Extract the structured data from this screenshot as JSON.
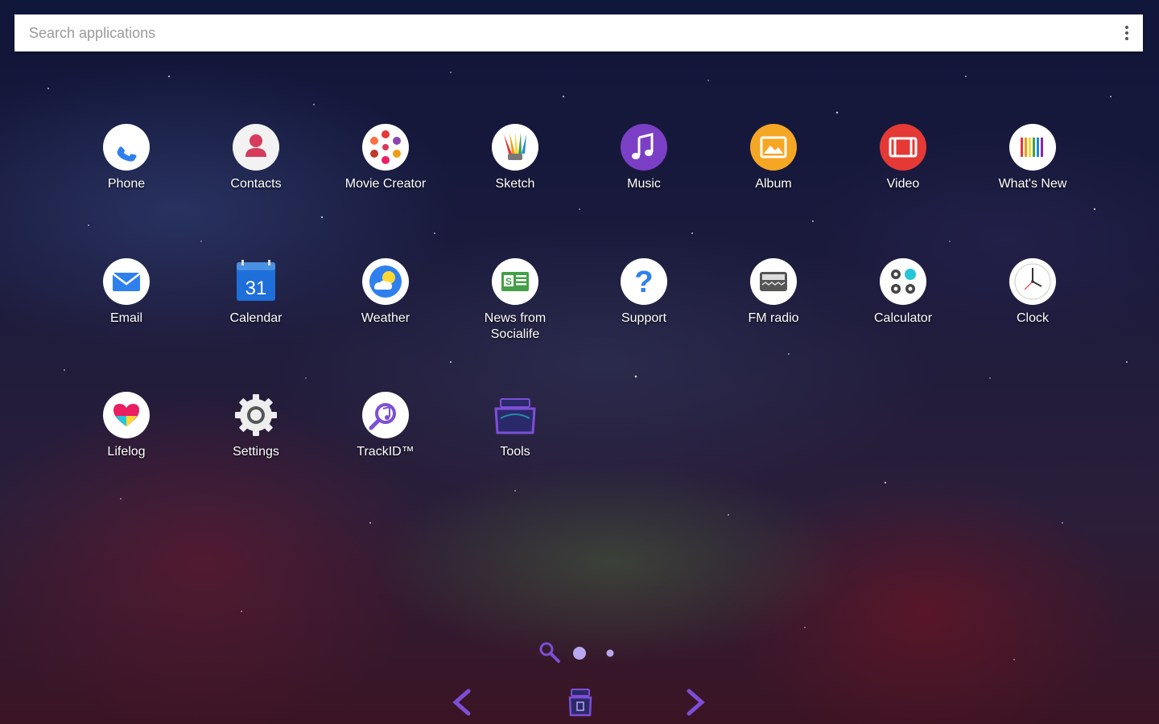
{
  "search": {
    "placeholder": "Search applications"
  },
  "apps": [
    {
      "label": "Phone",
      "icon": "phone-icon"
    },
    {
      "label": "Contacts",
      "icon": "contacts-icon"
    },
    {
      "label": "Movie Creator",
      "icon": "movie-creator-icon"
    },
    {
      "label": "Sketch",
      "icon": "sketch-icon"
    },
    {
      "label": "Music",
      "icon": "music-icon"
    },
    {
      "label": "Album",
      "icon": "album-icon"
    },
    {
      "label": "Video",
      "icon": "video-icon"
    },
    {
      "label": "What's New",
      "icon": "whats-new-icon"
    },
    {
      "label": "Email",
      "icon": "email-icon"
    },
    {
      "label": "Calendar",
      "icon": "calendar-icon",
      "date_text": "31"
    },
    {
      "label": "Weather",
      "icon": "weather-icon"
    },
    {
      "label": "News from\nSocialife",
      "line1": "News from",
      "line2": "Socialife",
      "icon": "news-icon"
    },
    {
      "label": "Support",
      "icon": "support-icon"
    },
    {
      "label": "FM radio",
      "icon": "fm-radio-icon"
    },
    {
      "label": "Calculator",
      "icon": "calculator-icon"
    },
    {
      "label": "Clock",
      "icon": "clock-icon"
    },
    {
      "label": "Lifelog",
      "icon": "lifelog-icon"
    },
    {
      "label": "Settings",
      "icon": "settings-icon"
    },
    {
      "label": "TrackID™",
      "icon": "trackid-icon"
    },
    {
      "label": "Tools",
      "icon": "tools-folder-icon"
    }
  ],
  "pager": {
    "pages": 2,
    "current": 1
  },
  "colors": {
    "phone": "#2f80ed",
    "contacts": "#d63b5c",
    "music": "#7b3fc6",
    "album": "#f5a623",
    "video": "#e53935",
    "accent_purple": "#7d4fd6"
  }
}
